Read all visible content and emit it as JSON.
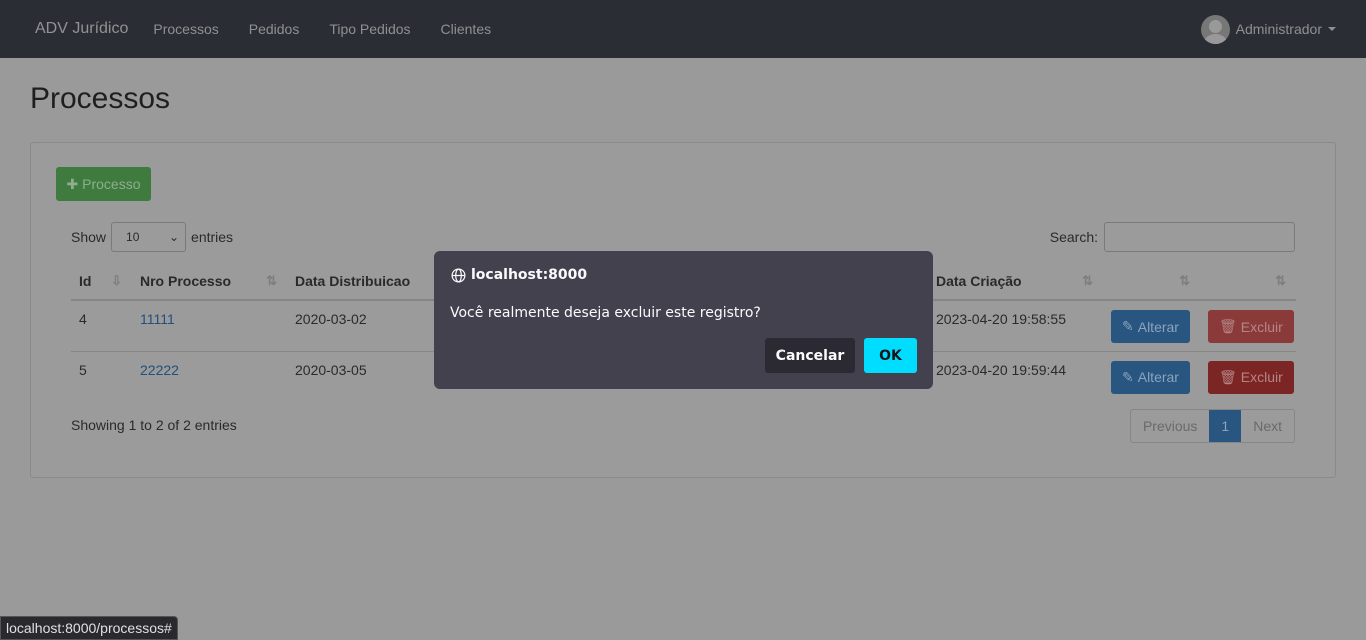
{
  "navbar": {
    "brand": "ADV Jurídico",
    "links": [
      "Processos",
      "Pedidos",
      "Tipo Pedidos",
      "Clientes"
    ],
    "user": "Administrador"
  },
  "page": {
    "title": "Processos",
    "add_button": "Processo"
  },
  "table_controls": {
    "show": "Show",
    "entries": "entries",
    "page_size": "10",
    "search_label": "Search:",
    "search_value": ""
  },
  "table": {
    "headers": [
      "Id",
      "Nro Processo",
      "Data Distribuicao",
      "",
      "Data Criação",
      "",
      ""
    ],
    "rows": [
      {
        "id": "4",
        "nro": "11111",
        "data_dist": "2020-03-02",
        "data_criacao": "2023-04-20 19:58:55",
        "edit": "Alterar",
        "delete": "Excluir"
      },
      {
        "id": "5",
        "nro": "22222",
        "data_dist": "2020-03-05",
        "data_criacao": "2023-04-20 19:59:44",
        "edit": "Alterar",
        "delete": "Excluir"
      }
    ]
  },
  "footer": {
    "info": "Showing 1 to 2 of 2 entries",
    "previous": "Previous",
    "page": "1",
    "next": "Next"
  },
  "dialog": {
    "origin": "localhost:8000",
    "message": "Você realmente deseja excluir este registro?",
    "cancel": "Cancelar",
    "ok": "OK"
  },
  "status_bar": "localhost:8000/processos#"
}
